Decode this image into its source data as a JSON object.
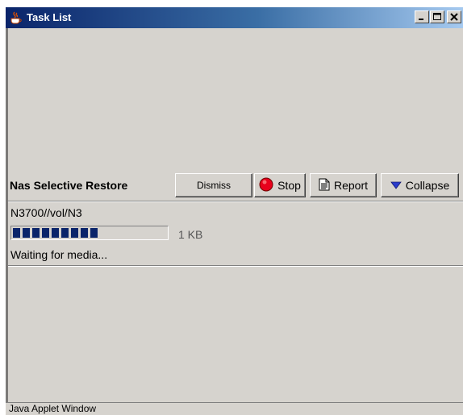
{
  "window": {
    "title": "Task List",
    "icon": "java-coffee-cup-icon",
    "controls": [
      "minimize-icon",
      "maximize-icon",
      "close-icon"
    ]
  },
  "task": {
    "title": "Nas Selective Restore",
    "buttons": {
      "dismiss": "Dismiss",
      "stop": "Stop",
      "report": "Report",
      "collapse": "Collapse"
    },
    "path": "N3700//vol/N3",
    "progress_percent": 60,
    "size": "1 KB",
    "status": "Waiting for media..."
  },
  "statusbar": {
    "text": "Java Applet Window"
  },
  "colors": {
    "titlebar_start": "#0a246a",
    "titlebar_end": "#a6caf0",
    "window_bg": "#d6d3ce",
    "progress_fill": "#0a246a",
    "stop_icon": "#e8001c",
    "collapse_icon": "#2a3ccc"
  }
}
